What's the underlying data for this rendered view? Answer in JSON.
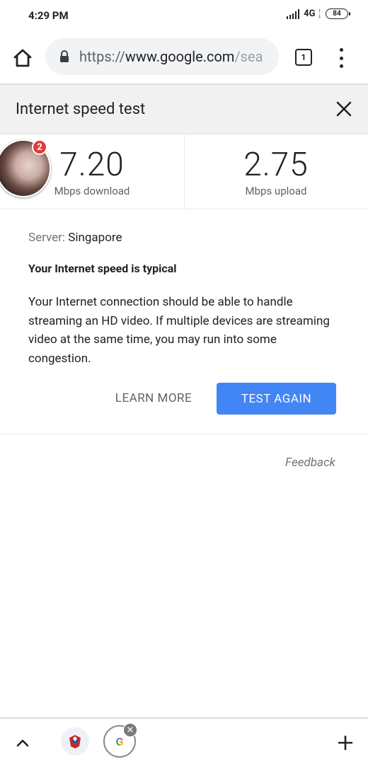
{
  "status_bar": {
    "time": "4:29 PM",
    "network": "4G",
    "battery": "84"
  },
  "toolbar": {
    "url_scheme": "https://",
    "url_host": "www.google.com",
    "url_path": "/sea",
    "tab_count": "1"
  },
  "card": {
    "title": "Internet speed test"
  },
  "results": {
    "download_value": "7.20",
    "download_unit": "Mbps download",
    "upload_value": "2.75",
    "upload_unit": "Mbps upload"
  },
  "chathead": {
    "badge_count": "2"
  },
  "content": {
    "server_label": "Server:",
    "server_value": "Singapore",
    "headline": "Your Internet speed is typical",
    "description": "Your Internet connection should be able to handle streaming an HD video. If multiple devices are streaming video at the same time, you may run into some congestion.",
    "learn_more": "LEARN MORE",
    "test_again": "TEST AGAIN"
  },
  "feedback": "Feedback",
  "bottom_bar": {
    "google_tab_letter": "G",
    "close_glyph": "✕"
  },
  "colors": {
    "accent": "#4285f4",
    "badge": "#e53935"
  }
}
